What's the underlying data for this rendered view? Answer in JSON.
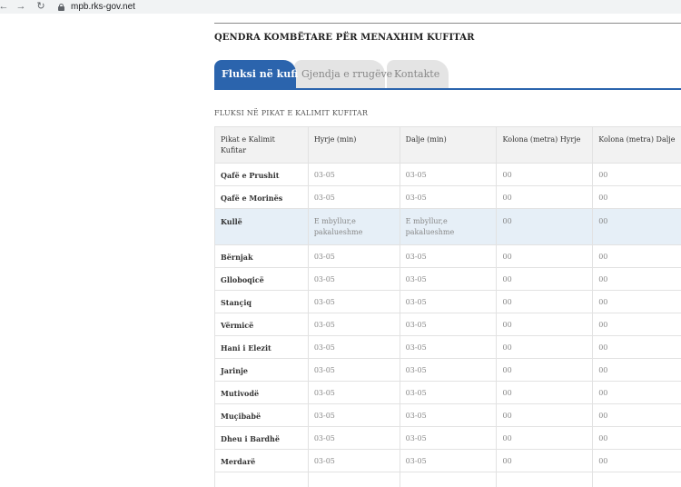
{
  "browser": {
    "url": "mpb.rks-gov.net"
  },
  "page": {
    "title": "QENDRA KOMBËTARE PËR MENAXHIM KUFITAR",
    "tabs": [
      {
        "label": "Fluksi në kufi",
        "active": true
      },
      {
        "label": "Gjendja e rrugëve",
        "active": false
      },
      {
        "label": "Kontakte",
        "active": false
      }
    ],
    "section_title": "FLUKSI NË PIKAT E KALIMIT KUFITAR"
  },
  "table": {
    "headers": [
      "Pikat e Kalimit Kufitar",
      "Hyrje (min)",
      "Dalje (min)",
      "Kolona (metra) Hyrje",
      "Kolona (metra) Dalje"
    ],
    "rows": [
      [
        "Qafë e Prushit",
        "03-05",
        "03-05",
        "00",
        "00"
      ],
      [
        "Qafë e Morinës",
        "03-05",
        "03-05",
        "00",
        "00"
      ],
      [
        "Kullë",
        "E mbyllur,e pakalueshme",
        "E mbyllur,e pakalueshme",
        "00",
        "00"
      ],
      [
        "Bërnjak",
        "03-05",
        "03-05",
        "00",
        "00"
      ],
      [
        "Glloboqicë",
        "03-05",
        "03-05",
        "00",
        "00"
      ],
      [
        "Stançiq",
        "03-05",
        "03-05",
        "00",
        "00"
      ],
      [
        "Vërmicë",
        "03-05",
        "03-05",
        "00",
        "00"
      ],
      [
        "Hani i Elezit",
        "03-05",
        "03-05",
        "00",
        "00"
      ],
      [
        "Jarinje",
        "03-05",
        "03-05",
        "00",
        "00"
      ],
      [
        "Mutivodë",
        "03-05",
        "03-05",
        "00",
        "00"
      ],
      [
        "Muçibabë",
        "03-05",
        "03-05",
        "00",
        "00"
      ],
      [
        "Dheu i Bardhë",
        "03-05",
        "03-05",
        "00",
        "00"
      ],
      [
        "Merdarë",
        "03-05",
        "03-05",
        "00",
        "00"
      ]
    ]
  },
  "colors": {
    "accent": "#2b64ad",
    "highlight_row": "#e6eff7",
    "inactive_tab": "#e4e4e4"
  }
}
